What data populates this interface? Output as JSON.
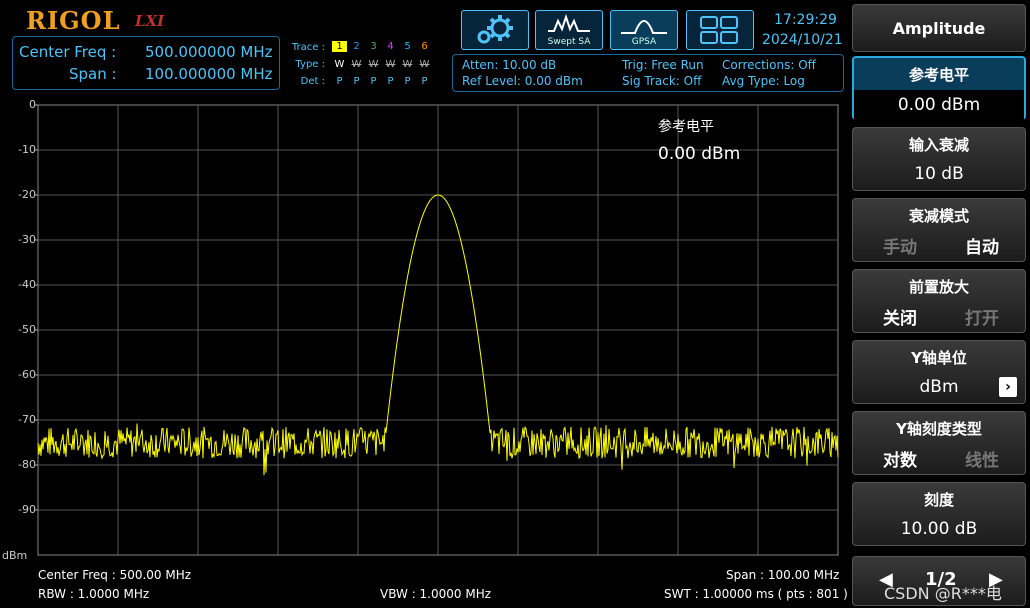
{
  "brand": {
    "logo": "RIGOL",
    "lxi": "LXI"
  },
  "header": {
    "center_freq_label": "Center Freq :",
    "center_freq_value": "500.000000 MHz",
    "span_label": "Span :",
    "span_value": "100.000000 MHz",
    "trace_label": "Trace :",
    "type_label": "Type :",
    "det_label": "Det :",
    "trace_nums": [
      "1",
      "2",
      "3",
      "4",
      "5",
      "6"
    ],
    "trace_colors": [
      "#ffff00",
      "#2196f3",
      "#4caf50",
      "#e040fb",
      "#29b6f6",
      "#ff9800"
    ],
    "types": [
      "W",
      "W",
      "W",
      "W",
      "W",
      "W"
    ],
    "dets": [
      "P",
      "P",
      "P",
      "P",
      "P",
      "P"
    ],
    "atten": "Atten: 10.00 dB",
    "ref_level": "Ref Level: 0.00 dBm",
    "trig": "Trig: Free Run",
    "sig_track": "Sig Track: Off",
    "corrections": "Corrections: Off",
    "avg_type": "Avg Type: Log",
    "modes": [
      "Swept SA",
      "GPSA"
    ],
    "time": "17:29:29",
    "date": "2024/10/21"
  },
  "plot": {
    "y_ticks": [
      "0",
      "-10",
      "-20",
      "-30",
      "-40",
      "-50",
      "-60",
      "-70",
      "-80",
      "-90"
    ],
    "y_unit": "dBm",
    "marker_label": "参考电平",
    "marker_value": "0.00 dBm",
    "center_freq": "Center Freq : 500.00 MHz",
    "span": "Span : 100.00 MHz",
    "rbw": "RBW : 1.0000 MHz",
    "vbw": "VBW : 1.0000 MHz",
    "swt": "SWT : 1.00000 ms ( pts : 801 )"
  },
  "chart_data": {
    "type": "line",
    "xlim": [
      450,
      550
    ],
    "ylim": [
      -100,
      0
    ],
    "grid": true,
    "noise_floor_dbm": -75,
    "peak": {
      "x_mhz": 500,
      "y_dbm": -20
    }
  },
  "menu": {
    "title": "Amplitude",
    "items": [
      {
        "title": "参考电平",
        "value": "0.00 dBm"
      },
      {
        "title": "输入衰减",
        "value": "10 dB"
      },
      {
        "title": "衰减模式",
        "opt_a": "手动",
        "opt_b": "自动"
      },
      {
        "title": "前置放大",
        "opt_a": "关闭",
        "opt_b": "打开"
      },
      {
        "title": "Y轴单位",
        "value": "dBm"
      },
      {
        "title": "Y轴刻度类型",
        "opt_a": "对数",
        "opt_b": "线性"
      },
      {
        "title": "刻度",
        "value": "10.00 dB"
      }
    ],
    "page": "1/2"
  },
  "watermark": "CSDN @R***电"
}
